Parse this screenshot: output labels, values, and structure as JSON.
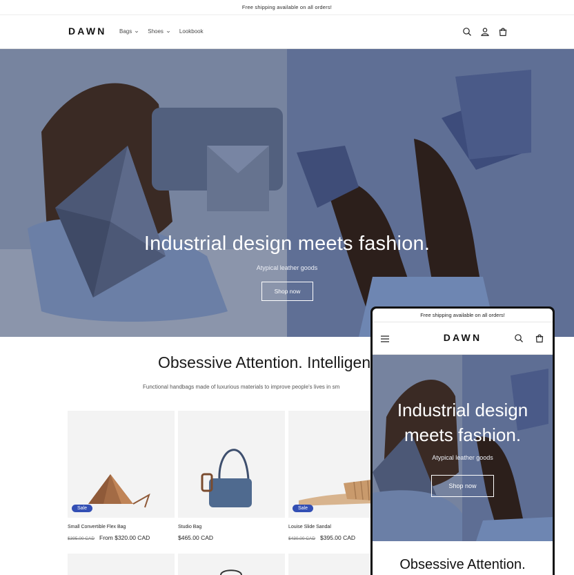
{
  "announcement": "Free shipping available on all orders!",
  "header": {
    "logo": "DAWN",
    "nav": [
      {
        "label": "Bags",
        "dropdown": true
      },
      {
        "label": "Shoes",
        "dropdown": true
      },
      {
        "label": "Lookbook",
        "dropdown": false
      }
    ],
    "icons": [
      "search-icon",
      "account-icon",
      "cart-icon"
    ]
  },
  "hero": {
    "title": "Industrial design meets fashion.",
    "subtitle": "Atypical leather goods",
    "button": "Shop now"
  },
  "collection": {
    "title": "Obsessive Attention. Intelligent",
    "subtitle": "Functional handbags made of luxurious materials to improve people's lives in sm"
  },
  "products": [
    {
      "name": "Small Convertible Flex Bag",
      "old_price": "$395.00 CAD",
      "price": "From $320.00 CAD",
      "badge": "Sale"
    },
    {
      "name": "Studio Bag",
      "old_price": "",
      "price": "$465.00 CAD",
      "badge": ""
    },
    {
      "name": "Louise Slide Sandal",
      "old_price": "$430.00 CAD",
      "price": "$395.00 CAD",
      "badge": "Sale"
    }
  ],
  "mobile": {
    "announcement": "Free shipping available on all orders!",
    "logo": "DAWN",
    "hero_title_line1": "Industrial design",
    "hero_title_line2": "meets fashion.",
    "hero_subtitle": "Atypical leather goods",
    "hero_button": "Shop now",
    "section_title": "Obsessive Attention."
  },
  "colors": {
    "sale_badge": "#334fb4",
    "hero_background": "#6c7b9c",
    "text": "#121212"
  }
}
